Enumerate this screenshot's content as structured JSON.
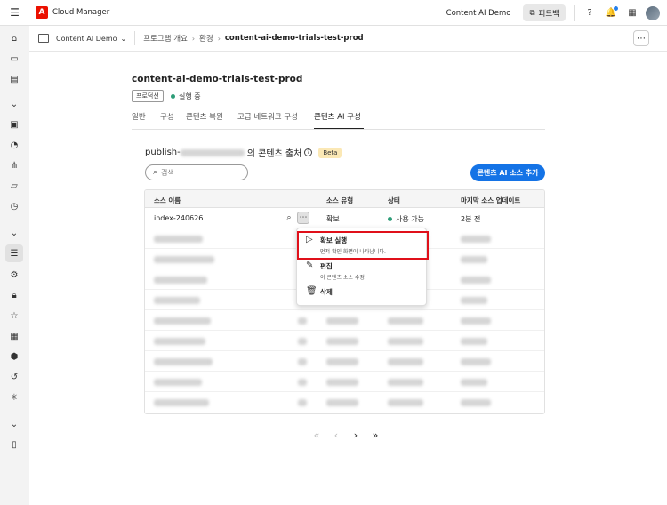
{
  "app": {
    "title": "Cloud Manager",
    "logo": "adobe-logo"
  },
  "topbar": {
    "org": "Content AI Demo",
    "feedback_label": "피드백"
  },
  "breadcrumb": {
    "program": "Content AI Demo",
    "items": [
      "프로그램 개요",
      "환경",
      "content-ai-demo-trials-test-prod"
    ]
  },
  "env": {
    "title": "content-ai-demo-trials-test-prod",
    "badge": "프로덕션",
    "status": "실행 중",
    "status_color": "#2d9d78"
  },
  "tabs": [
    "일반",
    "구성",
    "콘텐츠 복원",
    "고급 네트워크 구성",
    "콘텐츠 AI 구성"
  ],
  "sources": {
    "title_prefix": "publish-",
    "title_suffix": "의 콘텐츠 출처",
    "beta": "Beta",
    "search_placeholder": "검색",
    "add_button": "콘텐츠 AI 소스 추가",
    "columns": [
      "소스 이름",
      "소스 유형",
      "상태",
      "마지막 소스 업데이트"
    ],
    "first_row": {
      "name": "index-240626",
      "type": "확보",
      "status": "사용 가능",
      "updated": "2분 전"
    }
  },
  "context_menu": [
    {
      "label": "확보 실행",
      "desc": "먼저 확인 화면이 나타납니다."
    },
    {
      "label": "편집",
      "desc": "이 콘텐츠 소스 수정"
    },
    {
      "label": "삭제",
      "desc": ""
    }
  ],
  "colors": {
    "accent": "#1473e6",
    "highlight": "#e0101a",
    "brand": "#eb1000"
  }
}
